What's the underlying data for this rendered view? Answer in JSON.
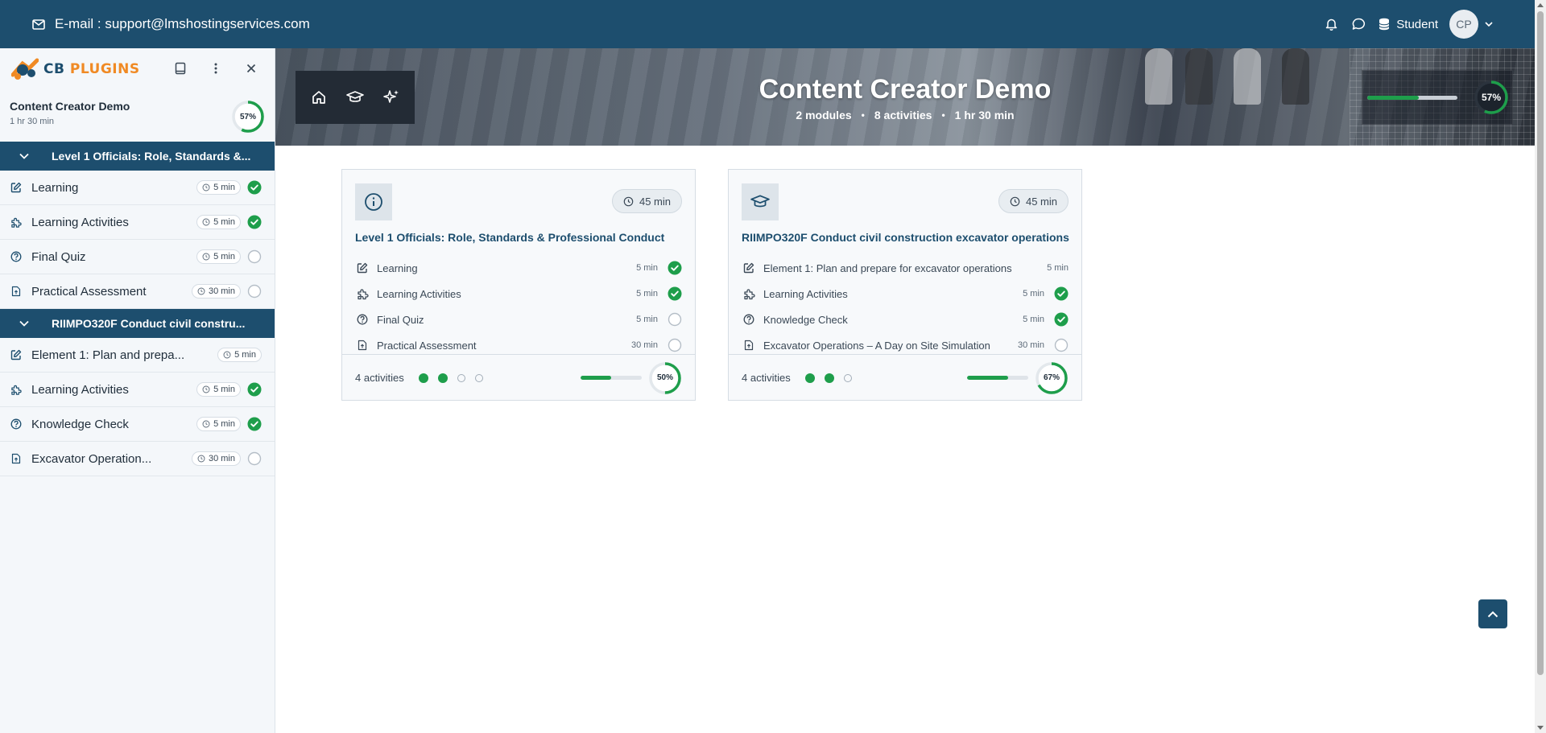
{
  "topbar": {
    "email": "E-mail : support@lmshostingservices.com",
    "role": "Student",
    "avatar_initials": "CP"
  },
  "brand": {
    "name_part1": "CB",
    "name_part2": "PLUGINS",
    "colors": {
      "primary": "#1d4e6e",
      "accent": "#f08a24",
      "success": "#1e9e4b"
    }
  },
  "sidebar": {
    "course_title": "Content Creator Demo",
    "course_duration": "1 hr 30 min",
    "progress_label": "57%",
    "progress": 0.57,
    "sections": [
      {
        "title": "Level 1 Officials: Role, Standards &...",
        "items": [
          {
            "label": "Learning",
            "time": "5 min",
            "icon": "edit-icon",
            "status": "complete"
          },
          {
            "label": "Learning Activities",
            "time": "5 min",
            "icon": "puzzle-icon",
            "status": "complete"
          },
          {
            "label": "Final Quiz",
            "time": "5 min",
            "icon": "question-icon",
            "status": "incomplete"
          },
          {
            "label": "Practical Assessment",
            "time": "30 min",
            "icon": "file-upload-icon",
            "status": "incomplete"
          }
        ]
      },
      {
        "title": "RIIMPO320F Conduct civil constru...",
        "items": [
          {
            "label": "Element 1: Plan and prepa...",
            "time": "5 min",
            "icon": "edit-icon",
            "status": "none"
          },
          {
            "label": "Learning Activities",
            "time": "5 min",
            "icon": "puzzle-icon",
            "status": "complete"
          },
          {
            "label": "Knowledge Check",
            "time": "5 min",
            "icon": "question-icon",
            "status": "complete"
          },
          {
            "label": "Excavator Operation...",
            "time": "30 min",
            "icon": "file-upload-icon",
            "status": "incomplete"
          }
        ]
      }
    ]
  },
  "hero": {
    "title": "Content Creator Demo",
    "modules": "2 modules",
    "activities": "8 activities",
    "duration": "1 hr 30 min",
    "dot": "•",
    "progress_label": "57%",
    "progress": 0.57,
    "icons": [
      "home-icon",
      "graduation-cap-icon",
      "sparkles-icon"
    ]
  },
  "cards": [
    {
      "icon": "info-icon",
      "duration": "45 min",
      "title": "Level 1 Officials: Role, Standards & Professional Conduct",
      "rows": [
        {
          "label": "Learning",
          "time": "5 min",
          "icon": "edit-icon",
          "status": "complete"
        },
        {
          "label": "Learning Activities",
          "time": "5 min",
          "icon": "puzzle-icon",
          "status": "complete"
        },
        {
          "label": "Final Quiz",
          "time": "5 min",
          "icon": "question-icon",
          "status": "incomplete"
        },
        {
          "label": "Practical Assessment",
          "time": "30 min",
          "icon": "file-upload-icon",
          "status": "incomplete"
        }
      ],
      "activities_label": "4 activities",
      "dots": [
        "on",
        "on",
        "off",
        "off"
      ],
      "progress_label": "50%",
      "progress": 0.5
    },
    {
      "icon": "graduation-cap-icon",
      "duration": "45 min",
      "title": "RIIMPO320F Conduct civil construction excavator operations",
      "rows": [
        {
          "label": "Element 1: Plan and prepare for excavator operations",
          "time": "5 min",
          "icon": "edit-icon",
          "status": "none"
        },
        {
          "label": "Learning Activities",
          "time": "5 min",
          "icon": "puzzle-icon",
          "status": "complete"
        },
        {
          "label": "Knowledge Check",
          "time": "5 min",
          "icon": "question-icon",
          "status": "complete"
        },
        {
          "label": "Excavator Operations – A Day on Site Simulation",
          "time": "30 min",
          "icon": "file-upload-icon",
          "status": "incomplete"
        }
      ],
      "activities_label": "4 activities",
      "dots": [
        "on",
        "on",
        "off"
      ],
      "progress_label": "67%",
      "progress": 0.67
    }
  ]
}
